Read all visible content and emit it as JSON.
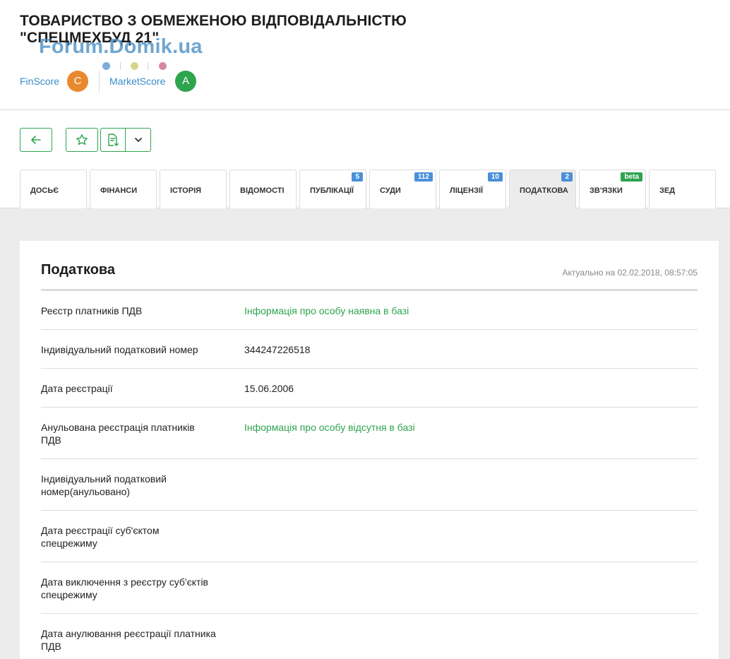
{
  "company": {
    "title": "ТОВАРИСТВО З ОБМЕЖЕНОЮ ВІДПОВІДАЛЬНІСТЮ \"СПЕЦМЕХБУД 21\""
  },
  "watermark": "Forum.Domik.ua",
  "scores": {
    "finscore_label": "FinScore",
    "finscore_grade": "C",
    "finscore_color": "#e8892f",
    "marketscore_label": "MarketScore",
    "marketscore_grade": "A",
    "marketscore_color": "#2ea44f",
    "dot_colors": [
      "#7aaed8",
      "#d4d68a",
      "#d68aa0"
    ]
  },
  "toolbar": {
    "back_icon": "arrow-left-icon",
    "favorite_icon": "star-icon",
    "export_icon": "document-download-icon",
    "dropdown_icon": "chevron-down-icon",
    "accent_color": "#2ea44f"
  },
  "tabs": [
    {
      "label": "ДОСЬЄ",
      "badge": ""
    },
    {
      "label": "ФІНАНСИ",
      "badge": ""
    },
    {
      "label": "ІСТОРІЯ",
      "badge": ""
    },
    {
      "label": "ВІДОМОСТІ",
      "badge": ""
    },
    {
      "label": "ПУБЛІКАЦІЇ",
      "badge": "5"
    },
    {
      "label": "СУДИ",
      "badge": "112"
    },
    {
      "label": "ЛІЦЕНЗІЇ",
      "badge": "10"
    },
    {
      "label": "ПОДАТКОВА",
      "badge": "2"
    },
    {
      "label": "ЗВ'ЯЗКИ",
      "badge": "beta"
    },
    {
      "label": "ЗЕД",
      "badge": ""
    }
  ],
  "active_tab": "ПОДАТКОВА",
  "card": {
    "title": "Податкова",
    "updated": "Актуально на 02.02.2018, 08:57:05",
    "rows": [
      {
        "label": "Реєстр платників ПДВ",
        "value": "Інформація про особу наявна в базі",
        "highlight": true
      },
      {
        "label": "Індивідуальний податковий номер",
        "value": "344247226518",
        "highlight": false
      },
      {
        "label": "Дата реєстрації",
        "value": "15.06.2006",
        "highlight": false
      },
      {
        "label": "Анульована реєстрація платників ПДВ",
        "value": "Інформація про особу відсутня в базі",
        "highlight": true
      },
      {
        "label": "Індивідуальний податковий номер(анульовано)",
        "value": "",
        "highlight": false
      },
      {
        "label": "Дата реєстрації суб'єктом спецрежиму",
        "value": "",
        "highlight": false
      },
      {
        "label": "Дата виключення з реєстру суб'єктів спецрежиму",
        "value": "",
        "highlight": false
      },
      {
        "label": "Дата анулювання реєстрації платника ПДВ",
        "value": "",
        "highlight": false
      }
    ]
  }
}
